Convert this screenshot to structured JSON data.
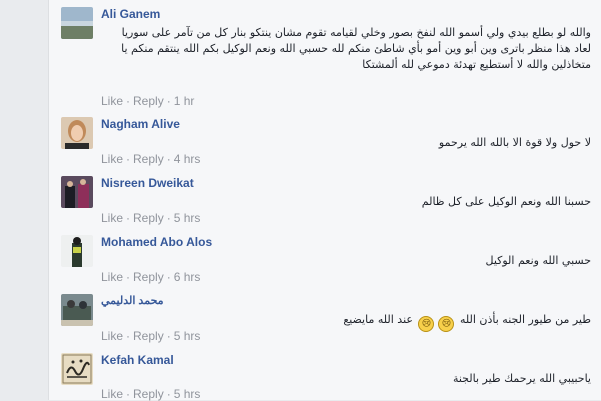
{
  "comments": [
    {
      "author": "Ali Ganem",
      "text": "والله لو بطلع بيدي ولي أسمو الله لنفخ بصور وخلي لقيامه تقوم مشان ينتكو بنار كل من تآمر على سوريا لعاد هذا منظر باترى وين أبو وين أمو بأي شاطئ منكم لله حسبي الله ونعم الوكيل بكم الله ينتقم منكم يا متخاذلين والله لا أستطيع تهدئة دموعي لله ألمشتكا",
      "like": "Like",
      "reply": "Reply",
      "time": "1 hr"
    },
    {
      "author": "Nagham Alive",
      "text": "لا حول ولا قوة الا بالله الله يرحمو",
      "like": "Like",
      "reply": "Reply",
      "time": "4 hrs"
    },
    {
      "author": "Nisreen Dweikat",
      "text": "حسبنا الله ونعم الوكيل على كل ظالم",
      "like": "Like",
      "reply": "Reply",
      "time": "5 hrs"
    },
    {
      "author": "Mohamed Abo Alos",
      "text": "حسبي الله ونعم الوكيل",
      "like": "Like",
      "reply": "Reply",
      "time": "6 hrs"
    },
    {
      "author": "محمد الدليمي",
      "text_before": "طير من طيور الجنه بأذن الله",
      "text_after": "عند الله مايضيع",
      "emoji": [
        "😢",
        "😢"
      ],
      "like": "Like",
      "reply": "Reply",
      "time": "5 hrs"
    },
    {
      "author": "Kefah Kamal",
      "text": "ياحبيبي الله يرحمك طير بالجنة",
      "like": "Like",
      "reply": "Reply",
      "time": "5 hrs"
    }
  ],
  "separator": "·"
}
